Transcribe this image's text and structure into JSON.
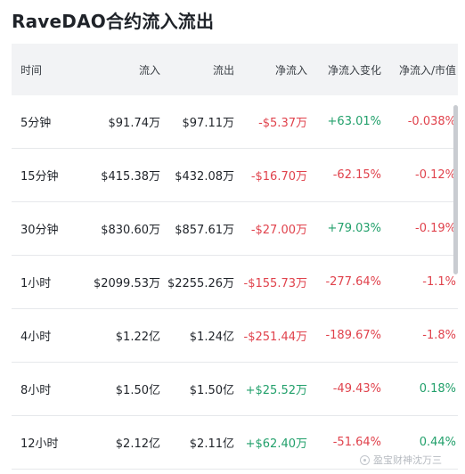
{
  "title": "RaveDAO合约流入流出",
  "headers": [
    "时间",
    "流入",
    "流出",
    "净流入",
    "净流入变化",
    "净流入/市值"
  ],
  "rows": [
    {
      "period": "5分钟",
      "inflow": "$91.74万",
      "outflow": "$97.11万",
      "net": "-$5.37万",
      "change": "+63.01%",
      "ratio": "-0.038%"
    },
    {
      "period": "15分钟",
      "inflow": "$415.38万",
      "outflow": "$432.08万",
      "net": "-$16.70万",
      "change": "-62.15%",
      "ratio": "-0.12%"
    },
    {
      "period": "30分钟",
      "inflow": "$830.60万",
      "outflow": "$857.61万",
      "net": "-$27.00万",
      "change": "+79.03%",
      "ratio": "-0.19%"
    },
    {
      "period": "1小时",
      "inflow": "$2099.53万",
      "outflow": "$2255.26万",
      "net": "-$155.73万",
      "change": "-277.64%",
      "ratio": "-1.1%"
    },
    {
      "period": "4小时",
      "inflow": "$1.22亿",
      "outflow": "$1.24亿",
      "net": "-$251.44万",
      "change": "-189.67%",
      "ratio": "-1.8%"
    },
    {
      "period": "8小时",
      "inflow": "$1.50亿",
      "outflow": "$1.50亿",
      "net": "+$25.52万",
      "change": "-49.43%",
      "ratio": "0.18%"
    },
    {
      "period": "12小时",
      "inflow": "$2.12亿",
      "outflow": "$2.11亿",
      "net": "+$62.40万",
      "change": "-51.64%",
      "ratio": "0.44%"
    }
  ],
  "watermark": "盈宝财神沈万三",
  "colors": {
    "positive": "#22a06b",
    "negative": "#e0424c",
    "header_bg": "#f2f3f5"
  }
}
